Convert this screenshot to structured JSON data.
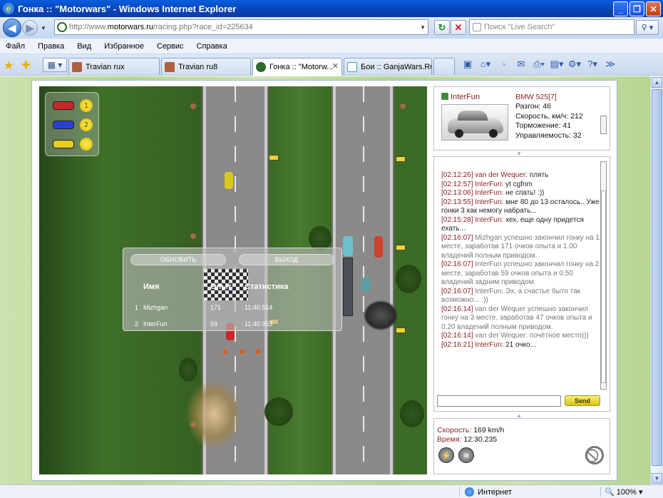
{
  "window": {
    "title": "Гонка :: \"Motorwars\" - Windows Internet Explorer"
  },
  "address": {
    "url_prefix": "http://www.",
    "url_host": "motorwars.ru",
    "url_path": "/racing.php?race_id=225634",
    "search_placeholder": "Поиск \"Live Search\""
  },
  "menu": [
    "Файл",
    "Правка",
    "Вид",
    "Избранное",
    "Сервис",
    "Справка"
  ],
  "tabs": [
    {
      "label": "Travian rux",
      "active": false
    },
    {
      "label": "Travian ru8",
      "active": false
    },
    {
      "label": "Гонка :: \"Motorw...",
      "active": true
    },
    {
      "label": "Бои :: GanjaWars.Ru...",
      "active": false
    }
  ],
  "game": {
    "legend": [
      {
        "color": "#c82828",
        "place": "1"
      },
      {
        "color": "#2b3fd0",
        "place": "2"
      },
      {
        "color": "#e8cc20",
        "place": ""
      }
    ],
    "results": {
      "refresh_label": "ОБНОВИТЬ",
      "exit_label": "ВЫХОД",
      "col_name": "Имя",
      "col_exp": "Опыт",
      "col_stats": "Статистика",
      "rows": [
        {
          "place": "1",
          "name": "Mizhgan",
          "exp": "171",
          "time": "11:40.514"
        },
        {
          "place": "2",
          "name": "InterFun",
          "exp": "59",
          "time": "11:40.953"
        }
      ]
    }
  },
  "player": {
    "name": "InterFun",
    "car_model": "BMW 525[7]",
    "stats": [
      "Разгон: 46",
      "Скорость, км/ч: 212",
      "Торможение: 41",
      "Управляемость: 32"
    ]
  },
  "chat": {
    "messages": [
      {
        "time": "[02:12:26]",
        "name": "van der Wequer:",
        "text": " плять",
        "system": false
      },
      {
        "time": "[02:12:57]",
        "name": "InterFun:",
        "text": " yt cgfnm",
        "system": false
      },
      {
        "time": "[02:13:06]",
        "name": "InterFun:",
        "text": " не спать! :))",
        "system": false
      },
      {
        "time": "[02:13:55]",
        "name": "InterFun:",
        "text": " мне 80 до 13 осталось.. Уже гонки 3 как немогу набрать...",
        "system": false
      },
      {
        "time": "[02:15:28]",
        "name": "InterFun:",
        "text": " хех, еще одну придется ехать...",
        "system": false
      },
      {
        "time": "[02:16:07]",
        "name": "",
        "text": " Mizhgan успешно закончил гонку на 1 месте, заработав 171 очков опыта и 1.00 владений полным приводом.",
        "system": true
      },
      {
        "time": "[02:16:07]",
        "name": "",
        "text": " InterFun успешно закончил гонку на 2 месте, заработав 59 очков опыта и 0.50 владений задним приводом.",
        "system": true
      },
      {
        "time": "[02:16:07]",
        "name": "",
        "text": " InterFun: Эх, а счастье быто так возможно... :))",
        "system": true
      },
      {
        "time": "[02:16:14]",
        "name": "",
        "text": " van der Wequer успешно закончил гонку на 3 месте, заработав 47 очков опыта и 0.20 владений полным приводом.",
        "system": true
      },
      {
        "time": "[02:16:14]",
        "name": "",
        "text": " van der Wequer: почётное место)))",
        "system": true
      },
      {
        "time": "[02:16:21]",
        "name": "InterFun:",
        "text": " 21 очко...",
        "system": false
      }
    ],
    "send_label": "Send"
  },
  "speed_panel": {
    "speed_label": "Скорость:",
    "speed_value": "169 km/h",
    "time_label": "Время:",
    "time_value": "12:30.235"
  },
  "status": {
    "zone": "Интернет",
    "zoom": "100%"
  }
}
